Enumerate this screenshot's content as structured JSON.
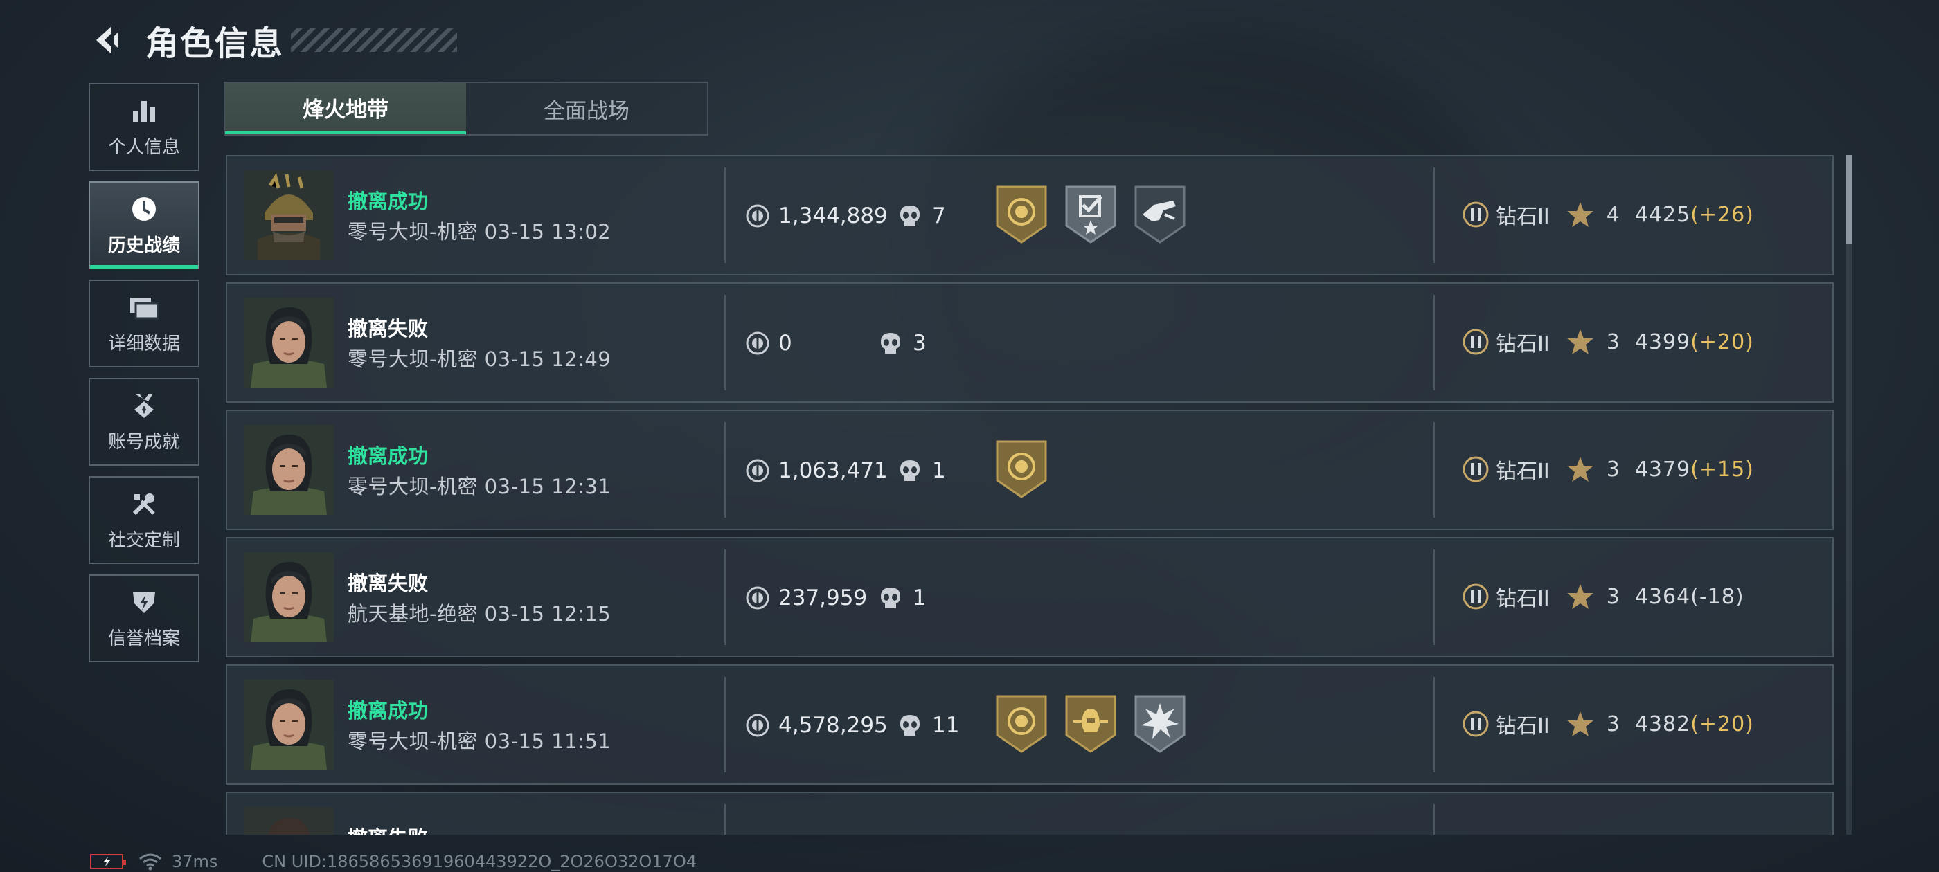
{
  "header": {
    "title": "角色信息",
    "back_icon": "back-arrow-icon"
  },
  "sidebar": {
    "items": [
      {
        "label": "个人信息",
        "icon": "bar-chart-icon",
        "active": false
      },
      {
        "label": "历史战绩",
        "icon": "clock-history-icon",
        "active": true
      },
      {
        "label": "详细数据",
        "icon": "folders-icon",
        "active": false
      },
      {
        "label": "账号成就",
        "icon": "medal-icon",
        "active": false
      },
      {
        "label": "社交定制",
        "icon": "tools-icon",
        "active": false
      },
      {
        "label": "信誉档案",
        "icon": "shield-bolt-icon",
        "active": false
      }
    ]
  },
  "tabs": [
    {
      "label": "烽火地带",
      "active": true
    },
    {
      "label": "全面战场",
      "active": false
    }
  ],
  "records": [
    {
      "status": "撤离成功",
      "success": true,
      "location": "零号大坝-机密 03-15 13:02",
      "value": "1,344,889",
      "kills": "7",
      "badges": [
        "gold-emblem-badge",
        "gray-check-star-badge",
        "dark-gun-badge"
      ],
      "rank": "钻石II",
      "stars": "4",
      "score": "4425",
      "delta": "(+26)"
    },
    {
      "status": "撤离失败",
      "success": false,
      "location": "零号大坝-机密 03-15 12:49",
      "value": "0",
      "kills": "3",
      "badges": [],
      "rank": "钻石II",
      "stars": "3",
      "score": "4399",
      "delta": "(+20)"
    },
    {
      "status": "撤离成功",
      "success": true,
      "location": "零号大坝-机密 03-15 12:31",
      "value": "1,063,471",
      "kills": "1",
      "badges": [
        "gold-emblem-badge"
      ],
      "rank": "钻石II",
      "stars": "3",
      "score": "4379",
      "delta": "(+15)"
    },
    {
      "status": "撤离失败",
      "success": false,
      "location": "航天基地-绝密 03-15 12:15",
      "value": "237,959",
      "kills": "1",
      "badges": [],
      "rank": "钻石II",
      "stars": "3",
      "score": "4364",
      "delta": "(-18)"
    },
    {
      "status": "撤离成功",
      "success": true,
      "location": "零号大坝-机密 03-15 11:51",
      "value": "4,578,295",
      "kills": "11",
      "badges": [
        "gold-emblem-badge",
        "gold-helmet-badge",
        "gray-burst-badge"
      ],
      "rank": "钻石II",
      "stars": "3",
      "score": "4382",
      "delta": "(+20)"
    },
    {
      "status": "撤离失败",
      "success": false,
      "location": "",
      "value": "",
      "kills": "",
      "badges": [],
      "rank": "",
      "stars": "",
      "score": "",
      "delta": ""
    }
  ],
  "statusbar": {
    "ping": "37ms",
    "uid": "CN UID:18658653691960443922O_2O26O32O17O4"
  },
  "colors": {
    "accent": "#2bd59a",
    "success": "#2fe19e",
    "delta_positive": "#e7c061",
    "battery_low": "#d23b3b"
  }
}
